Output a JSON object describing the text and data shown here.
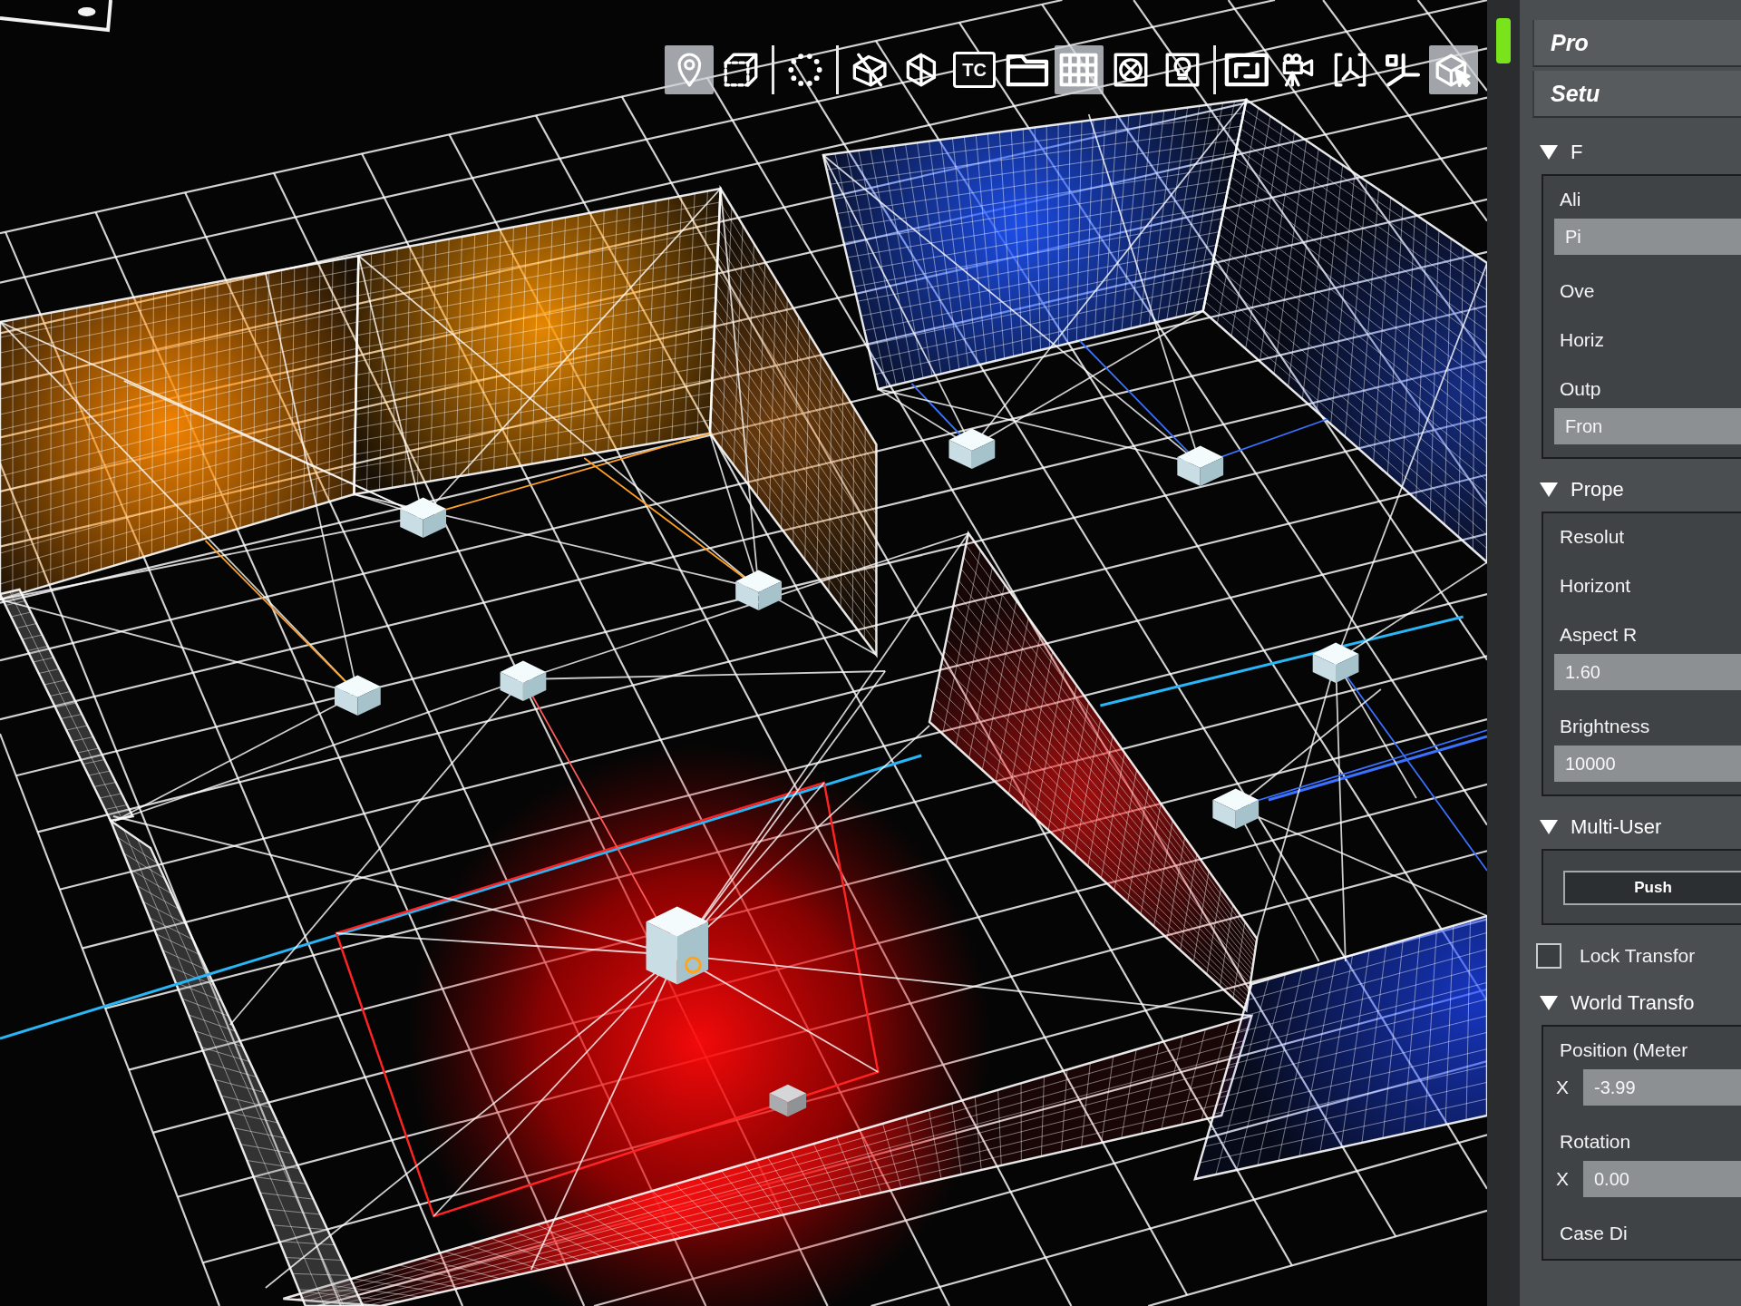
{
  "toolbar": {
    "groups": [
      {
        "items": [
          {
            "kind": "icon",
            "selected": true
          },
          {
            "kind": "icon",
            "selected": false
          }
        ]
      },
      {
        "items": [
          {
            "kind": "icon",
            "selected": false
          }
        ]
      },
      {
        "items": [
          {
            "kind": "icon",
            "selected": false
          },
          {
            "kind": "icon",
            "selected": false
          },
          {
            "kind": "text",
            "label": "TC",
            "selected": false
          },
          {
            "kind": "icon",
            "selected": false
          },
          {
            "kind": "icon",
            "selected": true
          },
          {
            "kind": "icon",
            "selected": false
          },
          {
            "kind": "icon",
            "selected": false
          }
        ]
      },
      {
        "items": [
          {
            "kind": "icon",
            "selected": false
          },
          {
            "kind": "icon",
            "selected": false
          },
          {
            "kind": "icon",
            "selected": false
          },
          {
            "kind": "icon",
            "selected": false
          },
          {
            "kind": "icon",
            "selected": true
          }
        ]
      }
    ]
  },
  "panel": {
    "header_buttons": [
      {
        "label": "Pro"
      },
      {
        "label": "Setu"
      }
    ],
    "items": [
      {
        "kind": "section",
        "title": "F",
        "expanded": true,
        "rows": [
          {
            "kind": "label",
            "text": "Ali"
          },
          {
            "kind": "field",
            "value": "Pi"
          },
          {
            "kind": "label",
            "text": "Ove"
          },
          {
            "kind": "label",
            "text": "Horiz"
          },
          {
            "kind": "label",
            "text": "Outp"
          },
          {
            "kind": "field",
            "value": "Fron"
          }
        ]
      },
      {
        "kind": "section",
        "title": "Prope",
        "expanded": true,
        "rows": [
          {
            "kind": "label",
            "text": "Resolut"
          },
          {
            "kind": "label",
            "text": "Horizont"
          },
          {
            "kind": "label",
            "text": "Aspect R"
          },
          {
            "kind": "field",
            "value": "1.60"
          },
          {
            "kind": "label",
            "text": "Brightness"
          },
          {
            "kind": "field",
            "value": "10000"
          }
        ]
      },
      {
        "kind": "section",
        "title": "Multi-User",
        "expanded": true,
        "rows": [
          {
            "kind": "button",
            "label": "Push"
          }
        ]
      },
      {
        "kind": "checkbox",
        "label": "Lock Transfor",
        "checked": false
      },
      {
        "kind": "section",
        "title": "World Transfo",
        "expanded": true,
        "rows": [
          {
            "kind": "label",
            "text": "Position (Meter"
          },
          {
            "kind": "axis_field",
            "axis": "X",
            "value": "-3.99"
          },
          {
            "kind": "label",
            "text": "Rotation"
          },
          {
            "kind": "axis_field",
            "axis": "X",
            "value": "0.00"
          },
          {
            "kind": "label",
            "text": "Case Di"
          }
        ]
      }
    ]
  }
}
